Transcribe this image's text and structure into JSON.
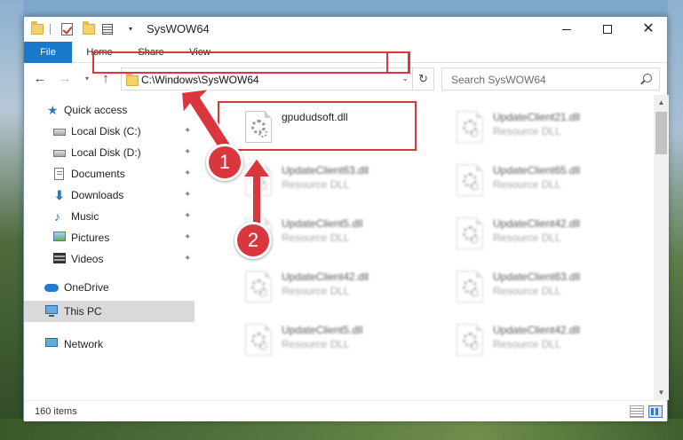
{
  "window": {
    "title": "SysWOW64",
    "minimize_icon": "minimize-icon",
    "maximize_icon": "maximize-icon",
    "close_glyph": "✕"
  },
  "quick_access_toolbar": {
    "icons": [
      "folder-icon",
      "properties-check-icon",
      "new-folder-icon",
      "customize-view-icon"
    ],
    "dropdown_glyph": "▾"
  },
  "ribbon": {
    "tabs": [
      {
        "label": "File",
        "active": true
      },
      {
        "label": "Home"
      },
      {
        "label": "Share"
      },
      {
        "label": "View"
      }
    ]
  },
  "navigation": {
    "back_glyph": "←",
    "forward_glyph": "→",
    "recent_glyph": "▾",
    "up_glyph": "↑",
    "address": "C:\\Windows\\SysWOW64",
    "address_dropdown_glyph": "⌄",
    "refresh_glyph": "↻",
    "search_placeholder": "Search SysWOW64"
  },
  "sidebar": {
    "items": [
      {
        "label": "Quick access",
        "icon": "quick-access-star-icon",
        "pinned": false
      },
      {
        "label": "Local Disk (C:)",
        "icon": "local-disk-icon",
        "pinned": true
      },
      {
        "label": "Local Disk (D:)",
        "icon": "local-disk-icon",
        "pinned": true
      },
      {
        "label": "Documents",
        "icon": "documents-icon",
        "pinned": true
      },
      {
        "label": "Downloads",
        "icon": "downloads-icon",
        "pinned": true
      },
      {
        "label": "Music",
        "icon": "music-icon",
        "pinned": true
      },
      {
        "label": "Pictures",
        "icon": "pictures-icon",
        "pinned": true
      },
      {
        "label": "Videos",
        "icon": "videos-icon",
        "pinned": true
      },
      {
        "label": "OneDrive",
        "icon": "onedrive-cloud-icon",
        "pinned": false
      },
      {
        "label": "This PC",
        "icon": "this-pc-icon",
        "pinned": false,
        "selected": true
      },
      {
        "label": "Network",
        "icon": "network-icon",
        "pinned": false
      }
    ],
    "pin_glyph": "📌"
  },
  "files": {
    "left_column": [
      {
        "name": "gpududsoft.dll",
        "type": "",
        "highlighted": true
      },
      {
        "name": "UpdateClient63.dll",
        "type": "Resource DLL"
      },
      {
        "name": "UpdateClient5.dll",
        "type": "Resource DLL"
      },
      {
        "name": "UpdateClient42.dll",
        "type": "Resource DLL"
      },
      {
        "name": "UpdateClient5.dll",
        "type": "Resource DLL"
      }
    ],
    "right_column": [
      {
        "name": "UpdateClient21.dll",
        "type": "Resource DLL"
      },
      {
        "name": "UpdateClient65.dll",
        "type": "Resource DLL"
      },
      {
        "name": "UpdateClient42.dll",
        "type": "Resource DLL"
      },
      {
        "name": "UpdateClient63.dll",
        "type": "Resource DLL"
      },
      {
        "name": "UpdateClient42.dll",
        "type": "Resource DLL"
      }
    ]
  },
  "scrollbar": {
    "up_glyph": "▲",
    "down_glyph": "▼"
  },
  "statusbar": {
    "item_count": "160 items"
  },
  "annotations": {
    "step1": "1",
    "step2": "2",
    "accent_color": "#d9363e"
  },
  "colors": {
    "file_tab": "#1979ca",
    "selected_nav": "#d9d9d9"
  }
}
